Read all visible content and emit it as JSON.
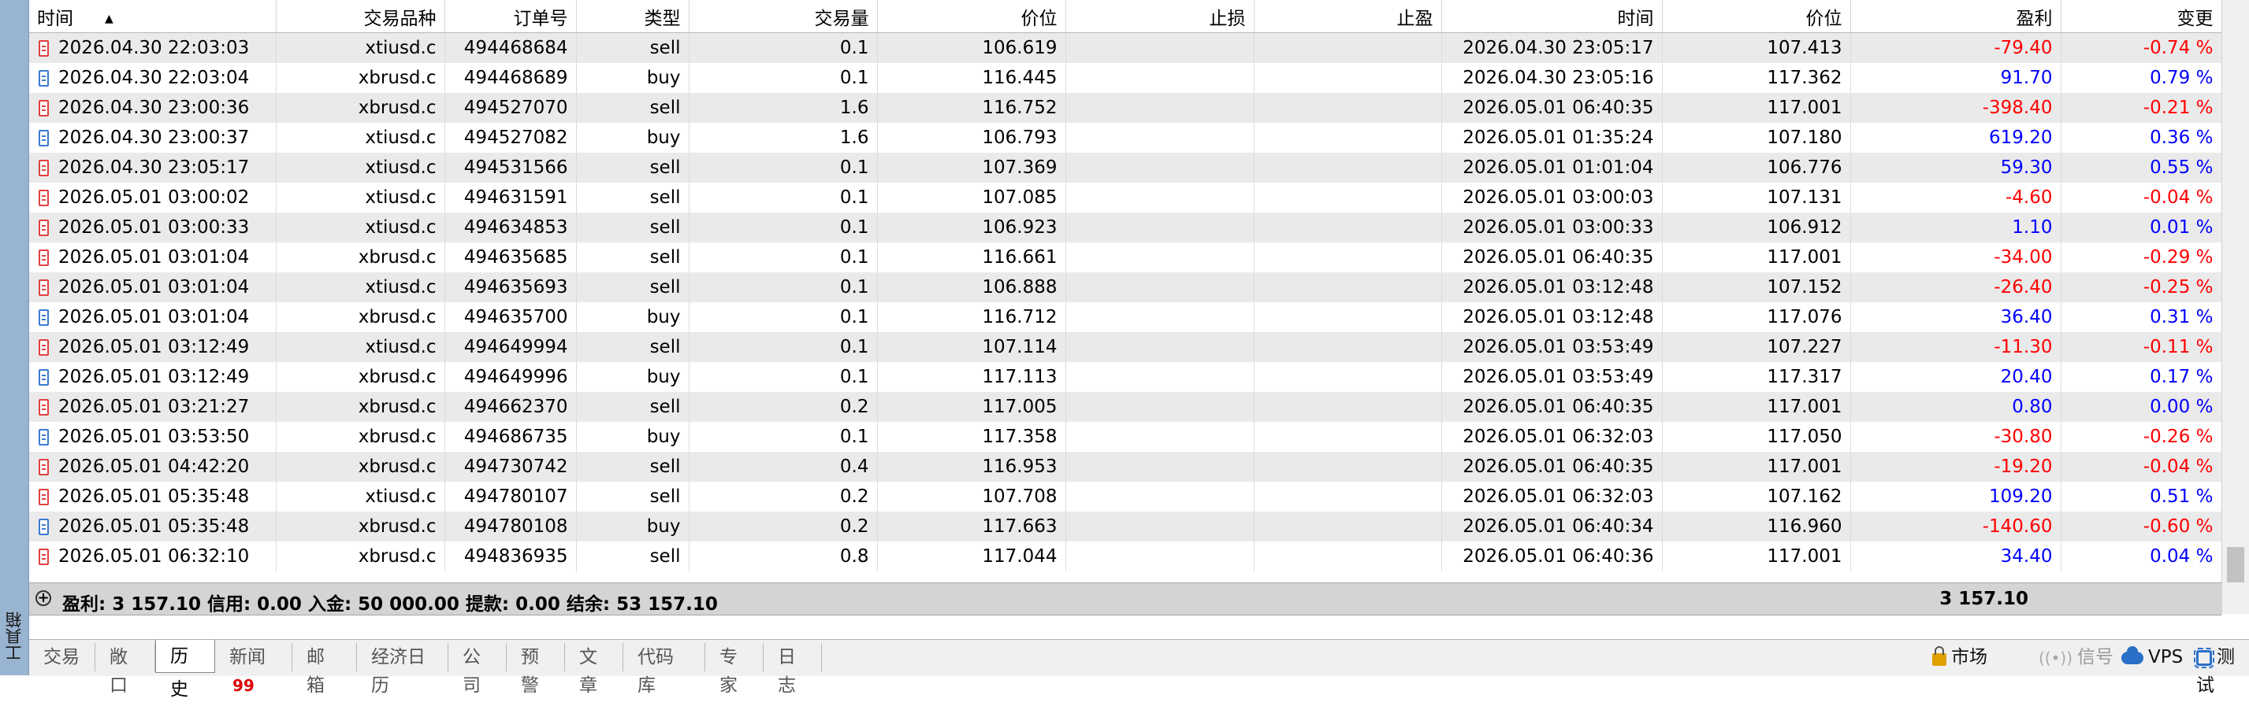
{
  "sidebar": {
    "label": "工具箱"
  },
  "columns": {
    "time": "时间",
    "symbol": "交易品种",
    "order": "订单号",
    "type": "类型",
    "volume": "交易量",
    "price": "价位",
    "sl": "止损",
    "tp": "止盈",
    "close_time": "时间",
    "close_price": "价位",
    "profit": "盈利",
    "change": "变更"
  },
  "rows": [
    {
      "time": "2026.04.30 22:03:03",
      "symbol": "xtiusd.c",
      "order": "494468684",
      "type": "sell",
      "volume": "0.1",
      "price": "106.619",
      "sl": "",
      "tp": "",
      "close_time": "2026.04.30 23:05:17",
      "close_price": "107.413",
      "profit": "-79.40",
      "change": "-0.74 %",
      "sign": "neg"
    },
    {
      "time": "2026.04.30 22:03:04",
      "symbol": "xbrusd.c",
      "order": "494468689",
      "type": "buy",
      "volume": "0.1",
      "price": "116.445",
      "sl": "",
      "tp": "",
      "close_time": "2026.04.30 23:05:16",
      "close_price": "117.362",
      "profit": "91.70",
      "change": "0.79 %",
      "sign": "pos"
    },
    {
      "time": "2026.04.30 23:00:36",
      "symbol": "xbrusd.c",
      "order": "494527070",
      "type": "sell",
      "volume": "1.6",
      "price": "116.752",
      "sl": "",
      "tp": "",
      "close_time": "2026.05.01 06:40:35",
      "close_price": "117.001",
      "profit": "-398.40",
      "change": "-0.21 %",
      "sign": "neg"
    },
    {
      "time": "2026.04.30 23:00:37",
      "symbol": "xtiusd.c",
      "order": "494527082",
      "type": "buy",
      "volume": "1.6",
      "price": "106.793",
      "sl": "",
      "tp": "",
      "close_time": "2026.05.01 01:35:24",
      "close_price": "107.180",
      "profit": "619.20",
      "change": "0.36 %",
      "sign": "pos"
    },
    {
      "time": "2026.04.30 23:05:17",
      "symbol": "xtiusd.c",
      "order": "494531566",
      "type": "sell",
      "volume": "0.1",
      "price": "107.369",
      "sl": "",
      "tp": "",
      "close_time": "2026.05.01 01:01:04",
      "close_price": "106.776",
      "profit": "59.30",
      "change": "0.55 %",
      "sign": "pos"
    },
    {
      "time": "2026.05.01 03:00:02",
      "symbol": "xtiusd.c",
      "order": "494631591",
      "type": "sell",
      "volume": "0.1",
      "price": "107.085",
      "sl": "",
      "tp": "",
      "close_time": "2026.05.01 03:00:03",
      "close_price": "107.131",
      "profit": "-4.60",
      "change": "-0.04 %",
      "sign": "neg"
    },
    {
      "time": "2026.05.01 03:00:33",
      "symbol": "xtiusd.c",
      "order": "494634853",
      "type": "sell",
      "volume": "0.1",
      "price": "106.923",
      "sl": "",
      "tp": "",
      "close_time": "2026.05.01 03:00:33",
      "close_price": "106.912",
      "profit": "1.10",
      "change": "0.01 %",
      "sign": "pos"
    },
    {
      "time": "2026.05.01 03:01:04",
      "symbol": "xbrusd.c",
      "order": "494635685",
      "type": "sell",
      "volume": "0.1",
      "price": "116.661",
      "sl": "",
      "tp": "",
      "close_time": "2026.05.01 06:40:35",
      "close_price": "117.001",
      "profit": "-34.00",
      "change": "-0.29 %",
      "sign": "neg"
    },
    {
      "time": "2026.05.01 03:01:04",
      "symbol": "xtiusd.c",
      "order": "494635693",
      "type": "sell",
      "volume": "0.1",
      "price": "106.888",
      "sl": "",
      "tp": "",
      "close_time": "2026.05.01 03:12:48",
      "close_price": "107.152",
      "profit": "-26.40",
      "change": "-0.25 %",
      "sign": "neg"
    },
    {
      "time": "2026.05.01 03:01:04",
      "symbol": "xbrusd.c",
      "order": "494635700",
      "type": "buy",
      "volume": "0.1",
      "price": "116.712",
      "sl": "",
      "tp": "",
      "close_time": "2026.05.01 03:12:48",
      "close_price": "117.076",
      "profit": "36.40",
      "change": "0.31 %",
      "sign": "pos"
    },
    {
      "time": "2026.05.01 03:12:49",
      "symbol": "xtiusd.c",
      "order": "494649994",
      "type": "sell",
      "volume": "0.1",
      "price": "107.114",
      "sl": "",
      "tp": "",
      "close_time": "2026.05.01 03:53:49",
      "close_price": "107.227",
      "profit": "-11.30",
      "change": "-0.11 %",
      "sign": "neg"
    },
    {
      "time": "2026.05.01 03:12:49",
      "symbol": "xbrusd.c",
      "order": "494649996",
      "type": "buy",
      "volume": "0.1",
      "price": "117.113",
      "sl": "",
      "tp": "",
      "close_time": "2026.05.01 03:53:49",
      "close_price": "117.317",
      "profit": "20.40",
      "change": "0.17 %",
      "sign": "pos"
    },
    {
      "time": "2026.05.01 03:21:27",
      "symbol": "xbrusd.c",
      "order": "494662370",
      "type": "sell",
      "volume": "0.2",
      "price": "117.005",
      "sl": "",
      "tp": "",
      "close_time": "2026.05.01 06:40:35",
      "close_price": "117.001",
      "profit": "0.80",
      "change": "0.00 %",
      "sign": "pos"
    },
    {
      "time": "2026.05.01 03:53:50",
      "symbol": "xbrusd.c",
      "order": "494686735",
      "type": "buy",
      "volume": "0.1",
      "price": "117.358",
      "sl": "",
      "tp": "",
      "close_time": "2026.05.01 06:32:03",
      "close_price": "117.050",
      "profit": "-30.80",
      "change": "-0.26 %",
      "sign": "neg"
    },
    {
      "time": "2026.05.01 04:42:20",
      "symbol": "xbrusd.c",
      "order": "494730742",
      "type": "sell",
      "volume": "0.4",
      "price": "116.953",
      "sl": "",
      "tp": "",
      "close_time": "2026.05.01 06:40:35",
      "close_price": "117.001",
      "profit": "-19.20",
      "change": "-0.04 %",
      "sign": "neg"
    },
    {
      "time": "2026.05.01 05:35:48",
      "symbol": "xtiusd.c",
      "order": "494780107",
      "type": "sell",
      "volume": "0.2",
      "price": "107.708",
      "sl": "",
      "tp": "",
      "close_time": "2026.05.01 06:32:03",
      "close_price": "107.162",
      "profit": "109.20",
      "change": "0.51 %",
      "sign": "pos"
    },
    {
      "time": "2026.05.01 05:35:48",
      "symbol": "xbrusd.c",
      "order": "494780108",
      "type": "buy",
      "volume": "0.2",
      "price": "117.663",
      "sl": "",
      "tp": "",
      "close_time": "2026.05.01 06:40:34",
      "close_price": "116.960",
      "profit": "-140.60",
      "change": "-0.60 %",
      "sign": "neg"
    },
    {
      "time": "2026.05.01 06:32:10",
      "symbol": "xbrusd.c",
      "order": "494836935",
      "type": "sell",
      "volume": "0.8",
      "price": "117.044",
      "sl": "",
      "tp": "",
      "close_time": "2026.05.01 06:40:36",
      "close_price": "117.001",
      "profit": "34.40",
      "change": "0.04 %",
      "sign": "pos"
    }
  ],
  "summary": {
    "text": "盈利: 3 157.10  信用: 0.00  入金: 50 000.00  提款: 0.00  结余: 53 157.10",
    "profit_total": "3 157.10"
  },
  "tabs": [
    {
      "label": "交易",
      "active": false
    },
    {
      "label": "敞口",
      "active": false
    },
    {
      "label": "历史",
      "active": true
    },
    {
      "label": "新闻",
      "badge": "99",
      "active": false
    },
    {
      "label": "邮箱",
      "active": false
    },
    {
      "label": "经济日历",
      "active": false
    },
    {
      "label": "公司",
      "active": false
    },
    {
      "label": "预警",
      "active": false
    },
    {
      "label": "文章",
      "active": false
    },
    {
      "label": "代码库",
      "active": false
    },
    {
      "label": "专家",
      "active": false
    },
    {
      "label": "日志",
      "active": false
    }
  ],
  "status": {
    "market": "市场",
    "signal": "信号",
    "vps": "VPS",
    "test": "测试"
  },
  "colors": {
    "negative": "#ff0000",
    "positive": "#0000ff",
    "row_alt": "#eaeaea",
    "sidebar": "#99b4d1"
  }
}
